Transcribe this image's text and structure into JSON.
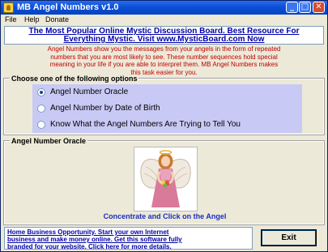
{
  "window": {
    "title": "MB Angel Numbers v1.0",
    "controls": {
      "minimize": "_",
      "maximize": "□",
      "close": "✕"
    }
  },
  "menu": {
    "items": [
      {
        "label": "File"
      },
      {
        "label": "Help"
      },
      {
        "label": "Donate"
      }
    ]
  },
  "banner": {
    "line1": "The Most Popular Online Mystic Discussion Board. Best Resource For",
    "line2": "Everything Mystic. Visit www.MysticBoard.com Now"
  },
  "intro": {
    "line1": "Angel Numbers show you the messages from your angels in the form of repeated",
    "line2": "numbers that you are most likely to see. These number sequences hold special",
    "line3": "meaning in your life if you are able to interpret them. MB Angel Numbers makes",
    "line4": "this task easier for you."
  },
  "options": {
    "legend": "Choose one of the following options",
    "items": [
      {
        "label": "Angel Number Oracle",
        "checked": true
      },
      {
        "label": "Angel Number by Date of Birth",
        "checked": false
      },
      {
        "label": "Know What the Angel Numbers Are Trying to Tell You",
        "checked": false
      }
    ]
  },
  "oracle": {
    "legend": "Angel Number Oracle",
    "caption": "Concentrate and Click on the Angel"
  },
  "footer": {
    "line1": "Home Business Opportunity. Start your own Internet",
    "line2": "business and make money online. Get this software fully",
    "line3": "branded for your website. Click here for more details.",
    "exit_label": "Exit"
  },
  "colors": {
    "titlebar": "#0a4fd6",
    "banner_text": "#0000aa",
    "intro_text": "#c00000",
    "options_panel": "#c9c9f5",
    "caption_text": "#1a2dbf"
  }
}
